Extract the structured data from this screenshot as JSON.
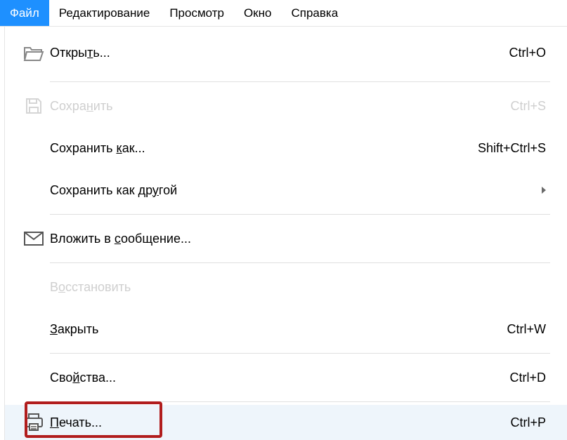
{
  "menubar": {
    "file": "Файл",
    "edit": "Редактирование",
    "view": "Просмотр",
    "window": "Окно",
    "help": "Справка"
  },
  "menu": {
    "open": {
      "pre": "Откры",
      "mn": "т",
      "post": "ь...",
      "shortcut": "Ctrl+O"
    },
    "save": {
      "pre": "Сохра",
      "mn": "н",
      "post": "ить",
      "shortcut": "Ctrl+S"
    },
    "saveAs": {
      "pre": "Сохранить ",
      "mn": "к",
      "post": "ак...",
      "shortcut": "Shift+Ctrl+S"
    },
    "saveAsOther": {
      "pre": "Сохранить как др",
      "mn": "у",
      "post": "гой"
    },
    "attach": {
      "pre": "Вложить в ",
      "mn": "с",
      "post": "ообщение..."
    },
    "revert": {
      "pre": "В",
      "mn": "о",
      "post": "сстановить"
    },
    "close": {
      "pre": "",
      "mn": "З",
      "post": "акрыть",
      "shortcut": "Ctrl+W"
    },
    "properties": {
      "pre": "Сво",
      "mn": "й",
      "post": "ства...",
      "shortcut": "Ctrl+D"
    },
    "print": {
      "pre": "",
      "mn": "П",
      "post": "ечать...",
      "shortcut": "Ctrl+P"
    }
  }
}
